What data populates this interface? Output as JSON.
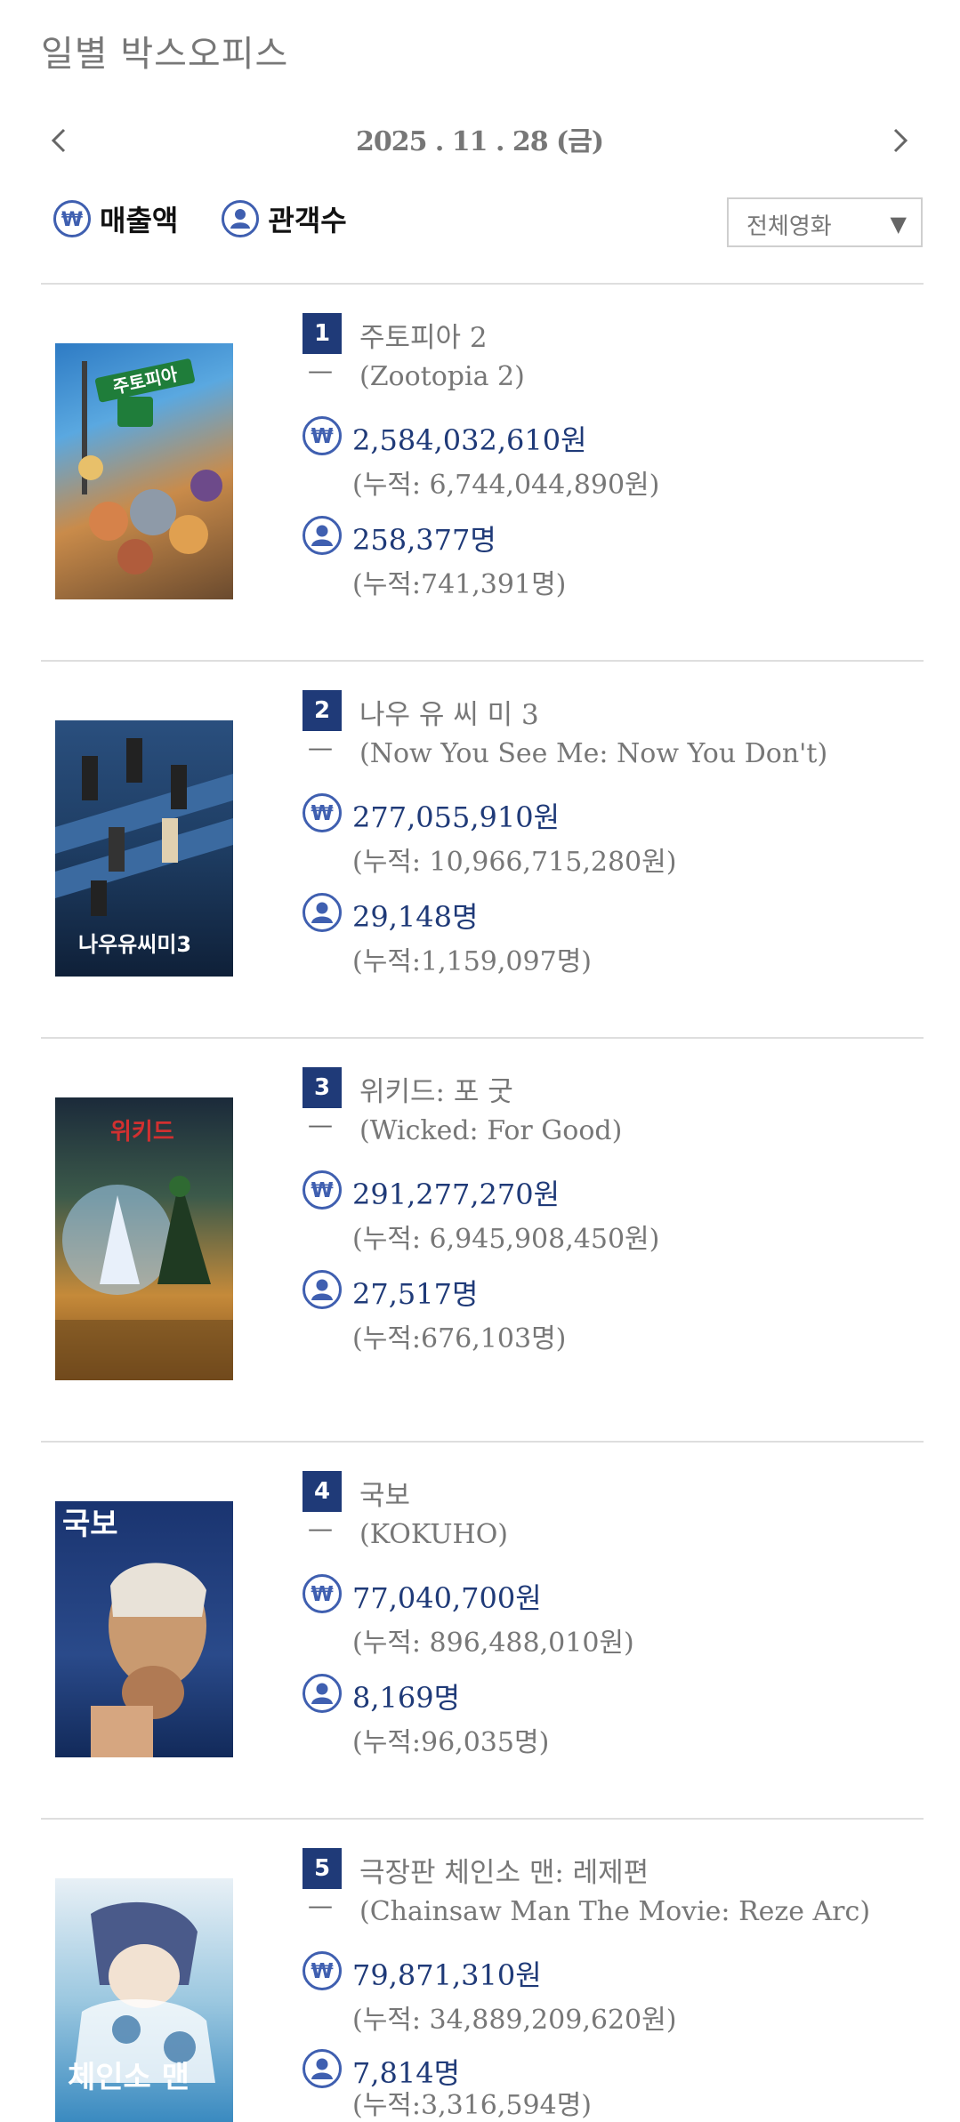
{
  "page_title": "일별 박스오피스",
  "date_nav": {
    "date": "2025 . 11 . 28 (금)"
  },
  "legend": {
    "sales_label": "매출액",
    "audience_label": "관객수"
  },
  "filter": {
    "selected": "전체영화"
  },
  "colors": {
    "accent": "#1f3a78",
    "icon": "#3f5fb0",
    "text_muted": "#777777",
    "divider": "#dedede"
  },
  "movies": [
    {
      "rank": "1",
      "title": "주토피아 2",
      "dash": "—",
      "original_title": "(Zootopia 2)",
      "sales": "2,584,032,610원",
      "sales_acc": "(누적: 6,744,044,890원)",
      "audience": "258,377명",
      "audience_acc": "(누적:741,391명)",
      "poster_text": "주토피아"
    },
    {
      "rank": "2",
      "title": "나우 유 씨 미 3",
      "dash": "—",
      "original_title": "(Now You See Me: Now You Don't)",
      "sales": "277,055,910원",
      "sales_acc": "(누적: 10,966,715,280원)",
      "audience": "29,148명",
      "audience_acc": "(누적:1,159,097명)",
      "poster_text": "나우유씨미3"
    },
    {
      "rank": "3",
      "title": "위키드: 포 굿",
      "dash": "—",
      "original_title": "(Wicked: For Good)",
      "sales": "291,277,270원",
      "sales_acc": "(누적: 6,945,908,450원)",
      "audience": "27,517명",
      "audience_acc": "(누적:676,103명)",
      "poster_text": "위키드"
    },
    {
      "rank": "4",
      "title": "국보",
      "dash": "—",
      "original_title": "(KOKUHO)",
      "sales": "77,040,700원",
      "sales_acc": "(누적: 896,488,010원)",
      "audience": "8,169명",
      "audience_acc": "(누적:96,035명)",
      "poster_text": "국보"
    },
    {
      "rank": "5",
      "title": "극장판 체인소 맨: 레제편",
      "dash": "—",
      "original_title": "(Chainsaw Man The Movie: Reze Arc)",
      "sales": "79,871,310원",
      "sales_acc": "(누적: 34,889,209,620원)",
      "audience": "7,814명",
      "audience_acc": "(누적:3,316,594명)",
      "poster_text": "체인소 맨"
    }
  ]
}
